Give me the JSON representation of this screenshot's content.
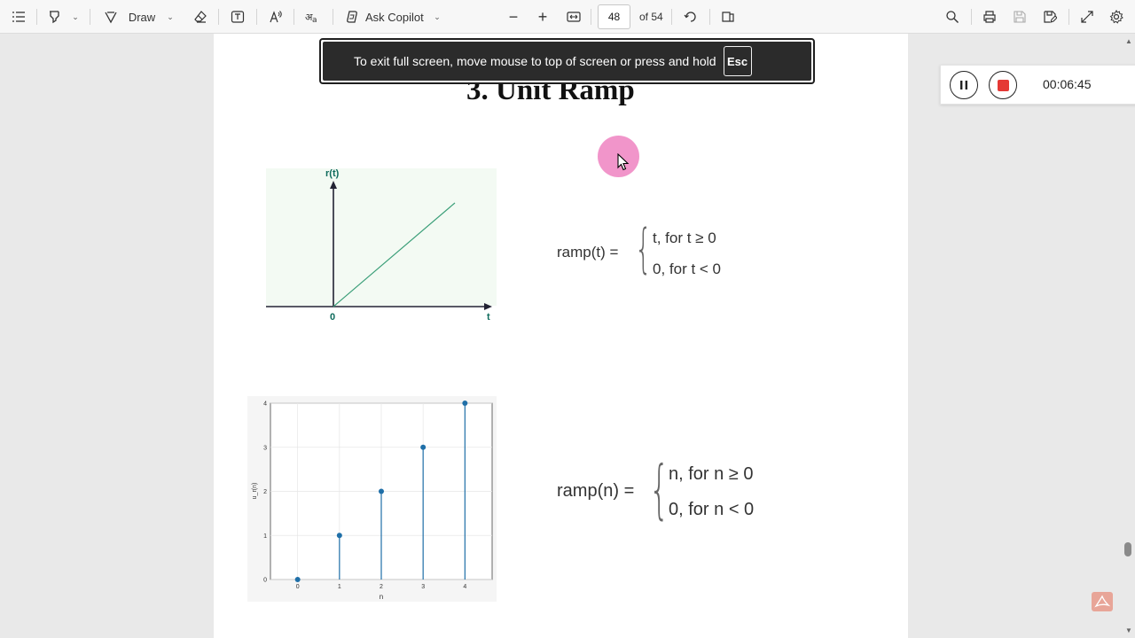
{
  "toolbar": {
    "draw_label": "Draw",
    "copilot_label": "Ask Copilot",
    "page_number": "48",
    "page_total": "of 54"
  },
  "banner": {
    "text": "To exit full screen, move mouse to top of screen or press and hold",
    "key": "Esc"
  },
  "recorder": {
    "time": "00:06:45"
  },
  "document": {
    "title": "3. Unit Ramp",
    "continuous_graph": {
      "y_label": "r(t)",
      "origin_label": "0",
      "x_label": "t"
    },
    "formula1": {
      "lhs": "ramp(t) =",
      "case1": "t, for t ≥ 0",
      "case2": "0, for t < 0"
    },
    "formula2": {
      "lhs": "ramp(n) =",
      "case1": "n, for n ≥ 0",
      "case2": "0, for n < 0"
    }
  },
  "chart_data": {
    "type": "scatter",
    "style": "stem",
    "x": [
      0,
      1,
      2,
      3,
      4
    ],
    "y": [
      0,
      1,
      2,
      3,
      4
    ],
    "x_ticks": [
      "0",
      "1",
      "2",
      "3",
      "4"
    ],
    "y_ticks": [
      "0",
      "1",
      "2",
      "3",
      "4"
    ],
    "xlabel": "n",
    "ylabel": "u_r(n)",
    "xlim": [
      -0.65,
      4.65
    ],
    "ylim": [
      0,
      4
    ],
    "grid": true,
    "color": "#1f6fa8"
  },
  "colors": {
    "cursor_highlight": "#ee82c1",
    "recorder_stop": "#e53935",
    "ramp_line": "#3a9e78",
    "axis_label": "#0e6b5c"
  }
}
